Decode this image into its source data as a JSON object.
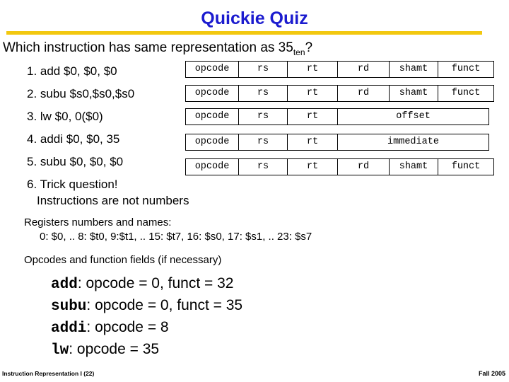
{
  "slide": {
    "title": "Quickie Quiz",
    "question_prefix": "Which instruction has same representation as 35",
    "question_sub": "ten",
    "question_suffix": "?",
    "answers": [
      "1. add $0, $0, $0",
      "2. subu $s0,$s0,$s0",
      "3. lw $0, 0($0)",
      "4. addi $0, $0, 35",
      "5.  subu $0, $0, $0",
      "6.  Trick question!"
    ],
    "answer6_sub": "Instructions  are not numbers",
    "formats": [
      {
        "cells": [
          "opcode",
          "rs",
          "rt",
          "rd",
          "shamt",
          "funct"
        ],
        "wide": false
      },
      {
        "cells": [
          "opcode",
          "rs",
          "rt",
          "rd",
          "shamt",
          "funct"
        ],
        "wide": false
      },
      {
        "cells": [
          "opcode",
          "rs",
          "rt",
          "offset"
        ],
        "wide": true
      },
      {
        "cells": [
          "opcode",
          "rs",
          "rt",
          "immediate"
        ],
        "wide": true
      },
      {
        "cells": [
          "opcode",
          "rs",
          "rt",
          "rd",
          "shamt",
          "funct"
        ],
        "wide": false
      }
    ],
    "notes": [
      "Registers numbers and names:",
      "0: $0, .. 8: $t0, 9:$t1, .. 15: $t7, 16: $s0, 17: $s1, .. 23: $s7",
      "Opcodes and function fields (if necessary)"
    ],
    "conclusions": [
      {
        "mono": "add",
        "rest": ": opcode = 0, funct = 32"
      },
      {
        "mono": "subu",
        "rest": ": opcode = 0, funct = 35"
      },
      {
        "mono": "addi",
        "rest": ": opcode = 8"
      },
      {
        "mono": "lw",
        "rest": ": opcode = 35"
      }
    ],
    "footer_left": "Instruction Representation I (22)",
    "footer_right": "Fall 2005",
    "colors": {
      "title": "#1b1bcf",
      "rule": "#f2c80f"
    }
  }
}
